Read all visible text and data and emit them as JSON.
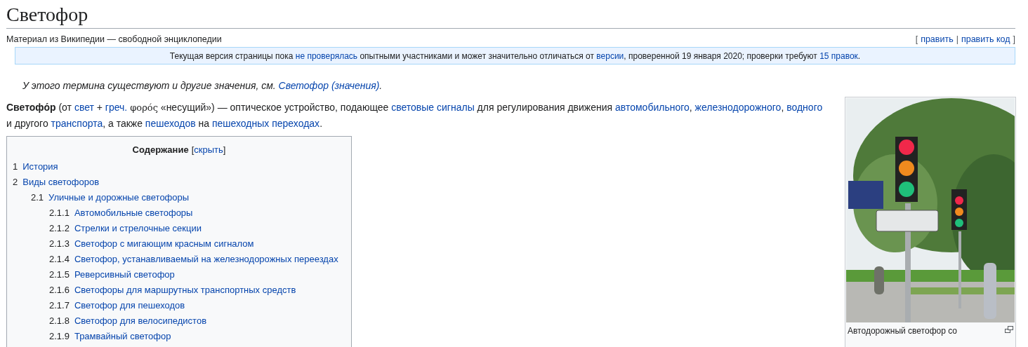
{
  "title": "Светофор",
  "subtitle": "Материал из Википедии — свободной энциклопедии",
  "edit_links": [
    {
      "kind": "text",
      "text": "["
    },
    {
      "kind": "link",
      "text": "править"
    },
    {
      "kind": "text",
      "text": "|"
    },
    {
      "kind": "link",
      "text": "править код"
    },
    {
      "kind": "text",
      "text": "]"
    }
  ],
  "notice": [
    {
      "kind": "text",
      "text": "Текущая версия страницы пока "
    },
    {
      "kind": "link",
      "text": "не проверялась"
    },
    {
      "kind": "text",
      "text": " опытными участниками и может значительно отличаться от "
    },
    {
      "kind": "link",
      "text": "версии"
    },
    {
      "kind": "text",
      "text": ", проверенной 19 января 2020; проверки требуют "
    },
    {
      "kind": "link",
      "text": "15 правок"
    },
    {
      "kind": "text",
      "text": "."
    }
  ],
  "hatnote": [
    {
      "kind": "text",
      "text": "У этого термина существуют и другие значения, см. "
    },
    {
      "kind": "link",
      "text": "Светофор (значения)"
    },
    {
      "kind": "text",
      "text": "."
    }
  ],
  "paragraph": [
    {
      "kind": "bold",
      "text": "Светофо́р"
    },
    {
      "kind": "text",
      "text": " (от "
    },
    {
      "kind": "link",
      "text": "свет"
    },
    {
      "kind": "text",
      "text": " + "
    },
    {
      "kind": "link",
      "text": "греч."
    },
    {
      "kind": "greek",
      "text": "φορός"
    },
    {
      "kind": "text",
      "text": " «несущий») — оптическое устройство, подающее "
    },
    {
      "kind": "link",
      "text": "световые сигналы"
    },
    {
      "kind": "text",
      "text": " для регулирования движения "
    },
    {
      "kind": "link",
      "text": "автомобильного"
    },
    {
      "kind": "text",
      "text": ", "
    },
    {
      "kind": "link",
      "text": "железнодорожного"
    },
    {
      "kind": "text",
      "text": ", "
    },
    {
      "kind": "link",
      "text": "водного"
    },
    {
      "kind": "text",
      "text": " и другого "
    },
    {
      "kind": "link",
      "text": "транспорта"
    },
    {
      "kind": "text",
      "text": ", а также "
    },
    {
      "kind": "link",
      "text": "пешеходов"
    },
    {
      "kind": "text",
      "text": " на "
    },
    {
      "kind": "link",
      "text": "пешеходных переходах"
    },
    {
      "kind": "text",
      "text": "."
    }
  ],
  "toc": {
    "title": "Содержание",
    "toggle": [
      {
        "kind": "text",
        "text": "["
      },
      {
        "kind": "link",
        "text": "скрыть"
      },
      {
        "kind": "text",
        "text": "]"
      }
    ],
    "items": [
      {
        "number": "1",
        "text": "История"
      },
      {
        "number": "2",
        "text": "Виды светофоров",
        "children": [
          {
            "number": "2.1",
            "text": "Уличные и дорожные светофоры",
            "children": [
              {
                "number": "2.1.1",
                "text": "Автомобильные светофоры"
              },
              {
                "number": "2.1.2",
                "text": "Стрелки и стрелочные секции"
              },
              {
                "number": "2.1.3",
                "text": "Светофор с мигающим красным сигналом"
              },
              {
                "number": "2.1.4",
                "text": "Светофор, устанавливаемый на железнодорожных переездах"
              },
              {
                "number": "2.1.5",
                "text": "Реверсивный светофор"
              },
              {
                "number": "2.1.6",
                "text": "Светофоры для маршрутных транспортных средств"
              },
              {
                "number": "2.1.7",
                "text": "Светофор для пешеходов"
              },
              {
                "number": "2.1.8",
                "text": "Светофор для велосипедистов"
              },
              {
                "number": "2.1.9",
                "text": "Трамвайный светофор"
              }
            ]
          }
        ]
      }
    ]
  },
  "figure": {
    "kind": "picture",
    "caption": "Автодорожный светофор со"
  }
}
